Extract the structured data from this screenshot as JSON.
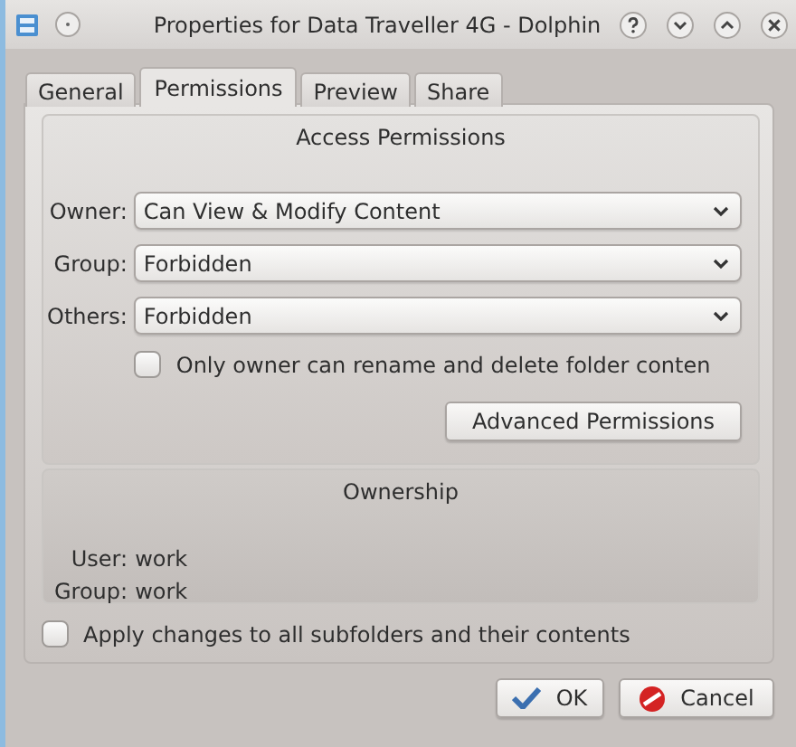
{
  "window": {
    "title": "Properties for Data Traveller 4G - Dolphin"
  },
  "tabs": [
    {
      "label": "General",
      "selected": false
    },
    {
      "label": "Permissions",
      "selected": true
    },
    {
      "label": "Preview",
      "selected": false
    },
    {
      "label": "Share",
      "selected": false
    }
  ],
  "access_permissions": {
    "title": "Access Permissions",
    "rows": [
      {
        "label": "Owner:",
        "value": "Can View & Modify Content"
      },
      {
        "label": "Group:",
        "value": "Forbidden"
      },
      {
        "label": "Others:",
        "value": "Forbidden"
      }
    ],
    "checkbox": {
      "label": "Only owner can rename and delete folder conten",
      "checked": false
    },
    "advanced_button": "Advanced Permissions"
  },
  "ownership": {
    "title": "Ownership",
    "rows": [
      {
        "label": "User:",
        "value": "work"
      },
      {
        "label": "Group:",
        "value": "work"
      }
    ]
  },
  "apply_checkbox": {
    "label": "Apply changes to all subfolders and their contents",
    "checked": false
  },
  "buttons": [
    {
      "label": "OK",
      "kind": "ok"
    },
    {
      "label": "Cancel",
      "kind": "cancel"
    }
  ]
}
